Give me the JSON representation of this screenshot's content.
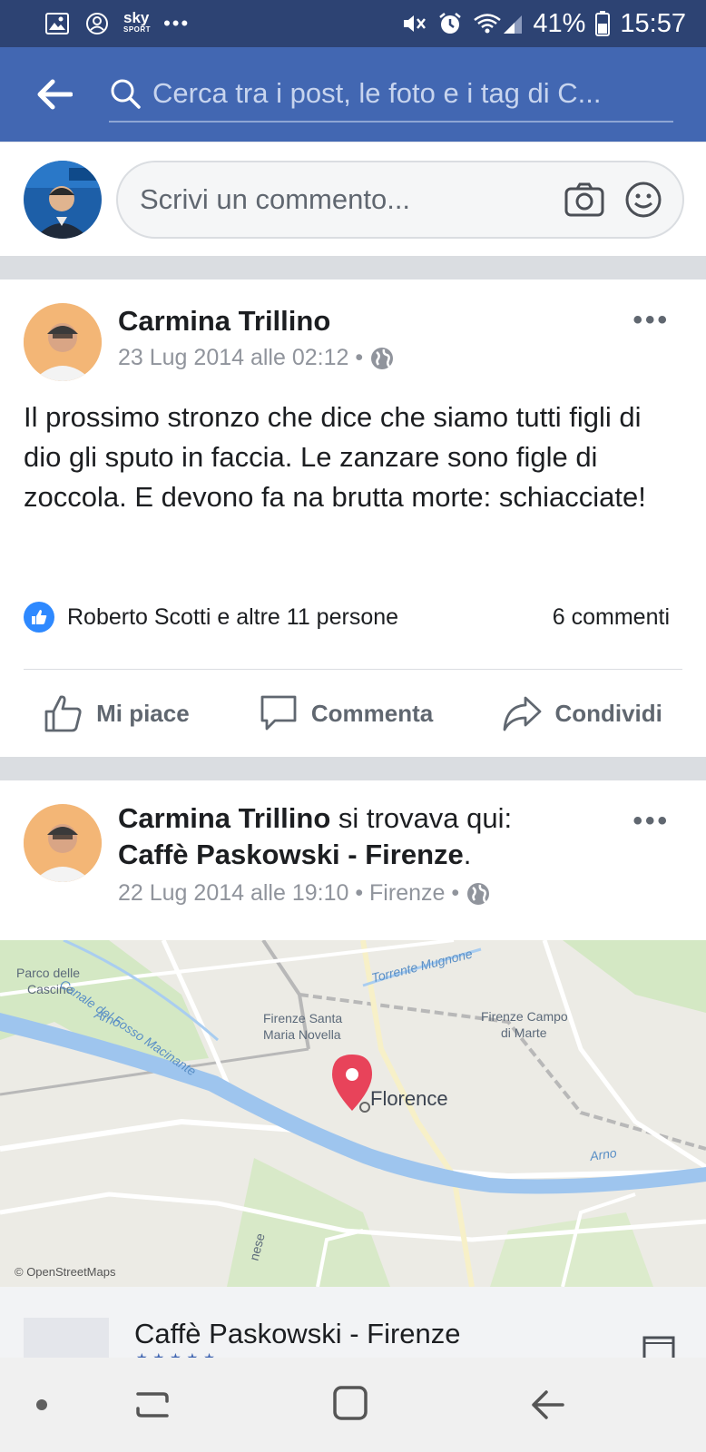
{
  "status_bar": {
    "battery": "41%",
    "time": "15:57",
    "sky_label": "sky",
    "sky_sub": "SPORT"
  },
  "header": {
    "search_placeholder": "Cerca tra i post, le foto e i tag di C..."
  },
  "composer": {
    "placeholder": "Scrivi un commento..."
  },
  "posts": [
    {
      "author": "Carmina Trillino",
      "timestamp": "23 Lug 2014 alle 02:12 •",
      "text": "Il prossimo stronzo che dice che siamo tutti figli di dio gli sputo in faccia. Le zanzare sono figle di zoccola. E devono fa na brutta morte: schiacciate!",
      "reactions_text": "Roberto Scotti e altre 11 persone",
      "comments_count": "6 commenti",
      "actions": {
        "like": "Mi piace",
        "comment": "Commenta",
        "share": "Condividi"
      }
    },
    {
      "author": "Carmina Trillino",
      "location_prefix": " si trovava qui:",
      "place": "Caffè Paskowski - Firenze",
      "place_suffix": ".",
      "timestamp": "22 Lug 2014 alle 19:10 • Firenze •"
    }
  ],
  "map": {
    "labels": {
      "parco": "Parco delle",
      "cascine": "Cascine",
      "canale": "Canale del Fosso Macinante",
      "arno_left": "Arno",
      "arno_right": "Arno",
      "torrente": "Torrente Mugnone",
      "smn1": "Firenze Santa",
      "smn2": "Maria Novella",
      "campo1": "Firenze Campo",
      "campo2": "di Marte",
      "florence": "Florence",
      "attribution": "© OpenStreetMaps",
      "street": "nese"
    }
  },
  "place_card": {
    "name": "Caffè Paskowski - Firenze",
    "stars": "★★★★★"
  },
  "colors": {
    "brand": "#4267b2",
    "status_bar": "#2d4373",
    "like_blue": "#2e89ff",
    "map_pin": "#e8435a",
    "river": "#9ec5ee"
  }
}
